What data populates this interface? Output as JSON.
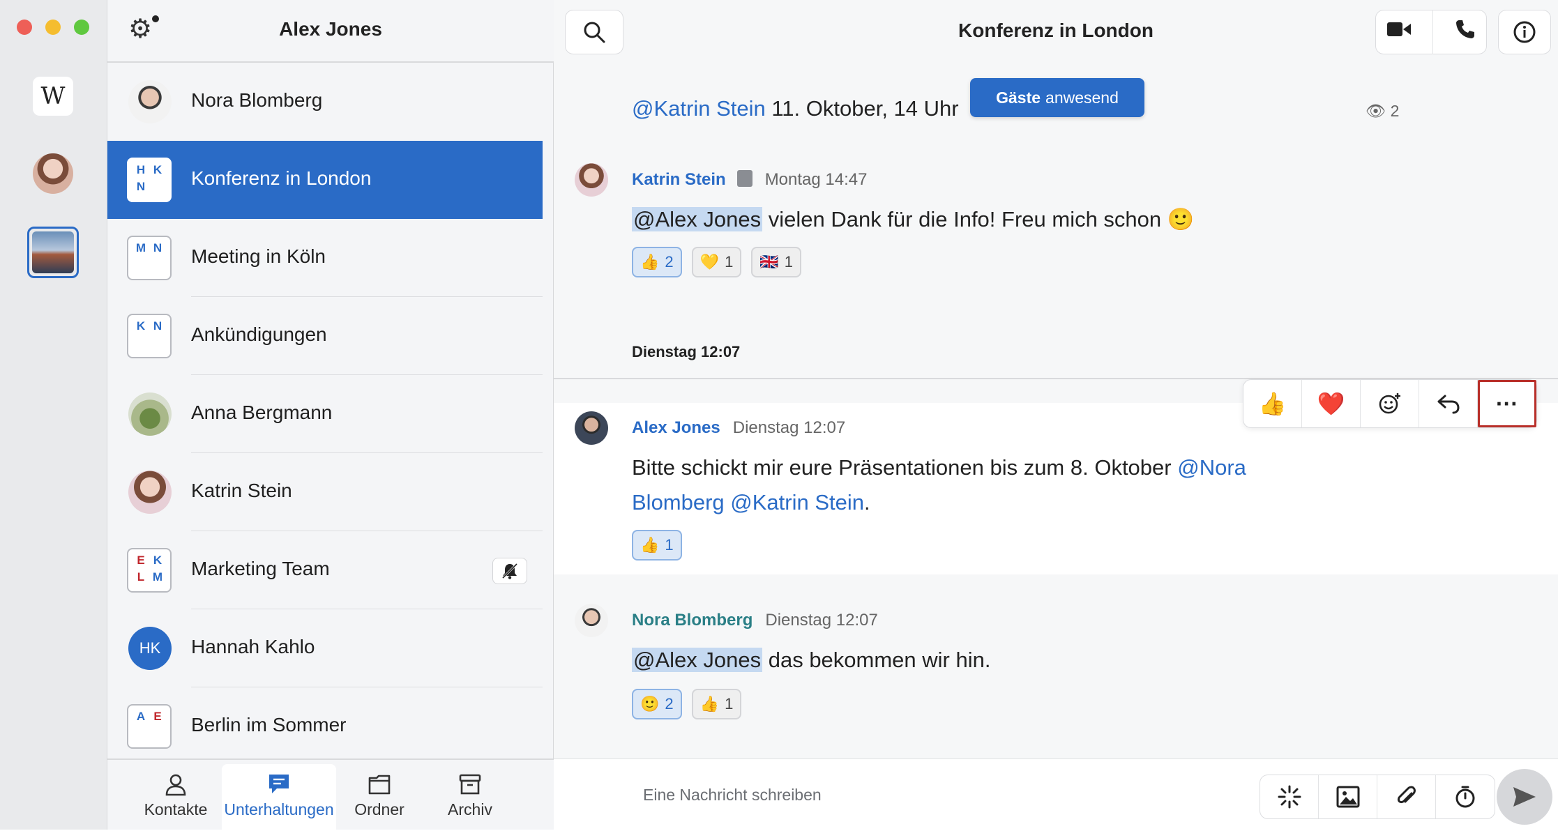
{
  "window": {
    "user_name": "Alex Jones"
  },
  "rail": {
    "logo": "W"
  },
  "conversations": [
    {
      "name": "Nora Blomberg",
      "type": "photo",
      "photo": "nora"
    },
    {
      "name": "Konferenz in London",
      "type": "group",
      "active": true,
      "initials": [
        [
          "H",
          "blue"
        ],
        [
          "K",
          "blue"
        ],
        [
          "N",
          "blue"
        ]
      ]
    },
    {
      "name": "Meeting in Köln",
      "type": "group",
      "initials": [
        [
          "M",
          "blue"
        ],
        [
          "N",
          "blue"
        ]
      ]
    },
    {
      "name": "Ankündigungen",
      "type": "group",
      "initials": [
        [
          "K",
          "blue"
        ],
        [
          "N",
          "blue"
        ]
      ]
    },
    {
      "name": "Anna Bergmann",
      "type": "photo",
      "photo": "anna"
    },
    {
      "name": "Katrin Stein",
      "type": "photo",
      "photo": "katrin"
    },
    {
      "name": "Marketing Team",
      "type": "group",
      "muted": true,
      "initials": [
        [
          "E",
          "red"
        ],
        [
          "K",
          "blue"
        ],
        [
          "L",
          "red"
        ],
        [
          "M",
          "blue"
        ]
      ]
    },
    {
      "name": "Hannah Kahlo",
      "type": "initials",
      "initials_text": "HK"
    },
    {
      "name": "Berlin im Sommer",
      "type": "group",
      "initials": [
        [
          "A",
          "blue"
        ],
        [
          "E",
          "red"
        ]
      ]
    }
  ],
  "tabs": [
    {
      "label": "Kontakte",
      "icon": "person-icon"
    },
    {
      "label": "Unterhaltungen",
      "icon": "chat-bubble-icon",
      "active": true
    },
    {
      "label": "Ordner",
      "icon": "folder-icon"
    },
    {
      "label": "Archiv",
      "icon": "archive-icon"
    }
  ],
  "chat": {
    "title": "Konferenz in London",
    "previous": {
      "mention": "@Katrin Stein",
      "text": " 11. Oktober, 14 Uhr"
    },
    "guest_banner": {
      "bold": "Gäste",
      "text": "anwesend"
    },
    "seen_count": "2",
    "day_label": "Dienstag 12:07",
    "composer_placeholder": "Eine Nachricht schreiben",
    "messages": [
      {
        "author": "Katrin Stein",
        "time": "Montag 14:47",
        "mention": "@Alex Jones",
        "text": " vielen Dank für die Info! Freu mich schon 🙂",
        "reactions": [
          {
            "emoji": "👍",
            "count": "2",
            "mine": true
          },
          {
            "emoji": "💛",
            "count": "1"
          },
          {
            "emoji": "🇬🇧",
            "count": "1"
          }
        ]
      },
      {
        "author": "Alex Jones",
        "time": "Dienstag 12:07",
        "line1_text": "Bitte schickt mir eure Präsentationen bis zum 8. Oktober ",
        "line1_mention": "@Nora",
        "line2_mention": "Blomberg @Katrin Stein",
        "line2_text": ".",
        "reactions": [
          {
            "emoji": "👍",
            "count": "1",
            "mine": true
          }
        ]
      },
      {
        "author": "Nora Blomberg",
        "time": "Dienstag 12:07",
        "mention": "@Alex Jones",
        "text": " das bekommen wir hin.",
        "reactions": [
          {
            "emoji": "🙂",
            "count": "2",
            "mine": true
          },
          {
            "emoji": "👍",
            "count": "1"
          }
        ]
      }
    ],
    "hover_actions": [
      "👍",
      "❤️",
      "emoji-add-icon",
      "reply-icon",
      "···"
    ]
  },
  "colors": {
    "accent": "#2a6bc6",
    "highlight": "#c5d9f1",
    "action_outline": "#b9302a"
  }
}
